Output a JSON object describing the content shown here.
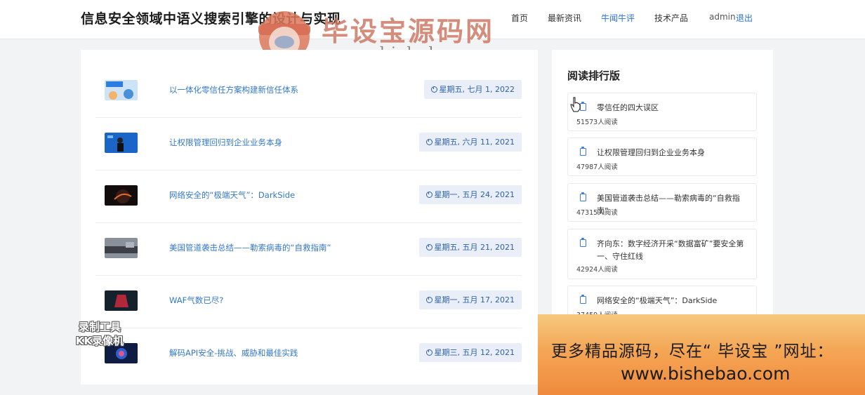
{
  "header": {
    "site_title": "信息安全领域中语义搜索引擎的设计与实现",
    "nav": [
      {
        "label": "首页",
        "active": false
      },
      {
        "label": "最新资讯",
        "active": false
      },
      {
        "label": "牛闻牛评",
        "active": true
      },
      {
        "label": "技术产品",
        "active": false
      }
    ],
    "user": "admin",
    "logout": "退出"
  },
  "watermark": {
    "brand": "毕设宝源码网",
    "url": "www.bishebao.com"
  },
  "articles": [
    {
      "title": "以一体化零信任方案构建新信任体系",
      "date": "星期五, 七月 1, 2022",
      "thumb_color": "#4a90d9"
    },
    {
      "title": "让权限管理回归到企业业务本身",
      "date": "星期五, 六月 11, 2021",
      "thumb_color": "#1b64c8"
    },
    {
      "title": "网络安全的“极端天气”：DarkSide",
      "date": "星期一, 五月 24, 2021",
      "thumb_color": "#2a1a1a"
    },
    {
      "title": "美国管道袭击总结——勒索病毒的“自救指南”",
      "date": "星期五, 五月 21, 2021",
      "thumb_color": "#5a6070"
    },
    {
      "title": "WAF气数已尽?",
      "date": "星期一, 五月 17, 2021",
      "thumb_color": "#1d2a3a"
    },
    {
      "title": "解码API安全-挑战、威胁和最佳实践",
      "date": "星期三, 五月 12, 2021",
      "thumb_color": "#1b2a55"
    }
  ],
  "ranking": {
    "title": "阅读排行版",
    "items": [
      {
        "title": "零信任的四大误区",
        "count": "51573人阅读"
      },
      {
        "title": "让权限管理回归到企业业务本身",
        "count": "47987人阅读"
      },
      {
        "title": "美国管道袭击总结——勒索病毒的“自救指南”",
        "count": "47315人阅读"
      },
      {
        "title": "齐向东：数字经济开采“数据富矿”要安全第一、守住红线",
        "count": "42924人阅读"
      },
      {
        "title": "网络安全的“极端天气”：DarkSide",
        "count": "37459人阅读"
      }
    ]
  },
  "promo": {
    "line1": "更多精品源码，尽在“ 毕设宝 ”网址：",
    "line2": "www.bishebao.com"
  },
  "recorder": {
    "line1": "录制工具",
    "line2": "KK录像机"
  }
}
